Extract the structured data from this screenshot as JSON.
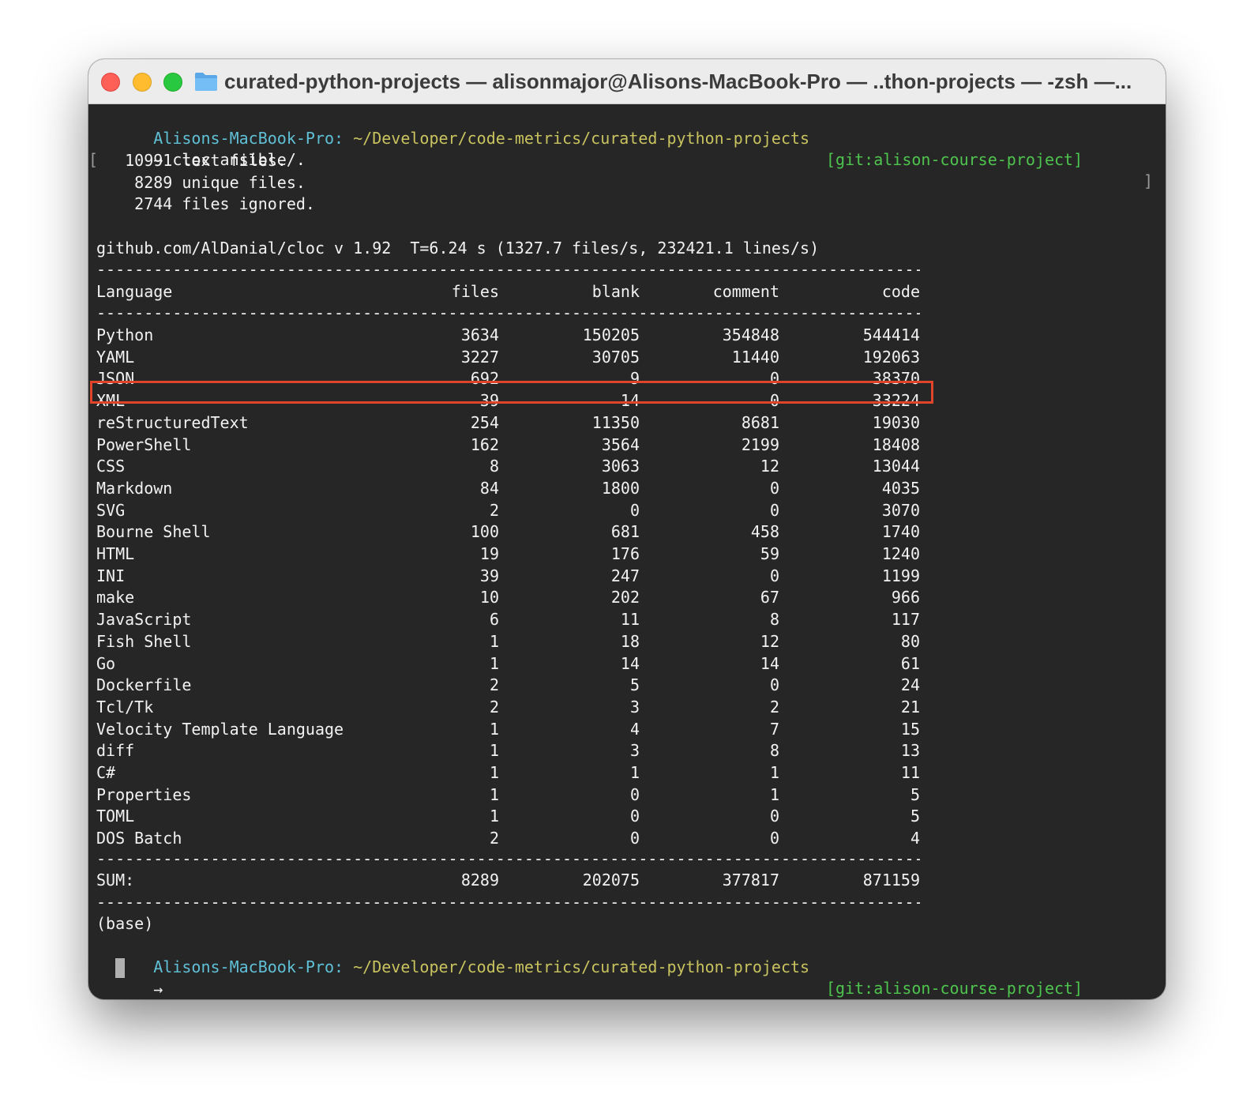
{
  "window": {
    "title": "curated-python-projects — alisonmajor@Alisons-MacBook-Pro — ..thon-projects — -zsh —..."
  },
  "prompt": {
    "host": "Alisons-MacBook-Pro:",
    "path": "~/Developer/code-metrics/curated-python-projects",
    "git": "[git:alison-course-project]",
    "arrow": "→"
  },
  "command": {
    "text": "cloc ansible/.",
    "left_bracket": "[",
    "right_bracket": "]"
  },
  "output": {
    "text_files": "   10991 text files.",
    "unique_files": "    8289 unique files.",
    "files_ignored": "    2744 files ignored.",
    "version_line": "github.com/AlDanial/cloc v 1.92  T=6.24 s (1327.7 files/s, 232421.1 lines/s)",
    "dashes": "---------------------------------------------------------------------------------------------------------------",
    "base": "(base)"
  },
  "table": {
    "headers": [
      "Language",
      "files",
      "blank",
      "comment",
      "code"
    ],
    "highlighted_row": "Python",
    "rows": [
      [
        "Python",
        "3634",
        "150205",
        "354848",
        "544414"
      ],
      [
        "YAML",
        "3227",
        "30705",
        "11440",
        "192063"
      ],
      [
        "JSON",
        "692",
        "9",
        "0",
        "38370"
      ],
      [
        "XML",
        "39",
        "14",
        "0",
        "33224"
      ],
      [
        "reStructuredText",
        "254",
        "11350",
        "8681",
        "19030"
      ],
      [
        "PowerShell",
        "162",
        "3564",
        "2199",
        "18408"
      ],
      [
        "CSS",
        "8",
        "3063",
        "12",
        "13044"
      ],
      [
        "Markdown",
        "84",
        "1800",
        "0",
        "4035"
      ],
      [
        "SVG",
        "2",
        "0",
        "0",
        "3070"
      ],
      [
        "Bourne Shell",
        "100",
        "681",
        "458",
        "1740"
      ],
      [
        "HTML",
        "19",
        "176",
        "59",
        "1240"
      ],
      [
        "INI",
        "39",
        "247",
        "0",
        "1199"
      ],
      [
        "make",
        "10",
        "202",
        "67",
        "966"
      ],
      [
        "JavaScript",
        "6",
        "11",
        "8",
        "117"
      ],
      [
        "Fish Shell",
        "1",
        "18",
        "12",
        "80"
      ],
      [
        "Go",
        "1",
        "14",
        "14",
        "61"
      ],
      [
        "Dockerfile",
        "2",
        "5",
        "0",
        "24"
      ],
      [
        "Tcl/Tk",
        "2",
        "3",
        "2",
        "21"
      ],
      [
        "Velocity Template Language",
        "1",
        "4",
        "7",
        "15"
      ],
      [
        "diff",
        "1",
        "3",
        "8",
        "13"
      ],
      [
        "C#",
        "1",
        "1",
        "1",
        "11"
      ],
      [
        "Properties",
        "1",
        "0",
        "1",
        "5"
      ],
      [
        "TOML",
        "1",
        "0",
        "0",
        "5"
      ],
      [
        "DOS Batch",
        "2",
        "0",
        "0",
        "4"
      ]
    ],
    "sum": [
      "SUM:",
      "8289",
      "202075",
      "377817",
      "871159"
    ]
  },
  "colors": {
    "terminal_bg": "#262626",
    "host": "#5fc0d6",
    "path": "#c9c35f",
    "git": "#4ec44e",
    "highlight_border": "#e0442a"
  },
  "icons": {
    "folder": "folder-icon",
    "close": "close-icon",
    "minimize": "minimize-icon",
    "zoom": "zoom-icon"
  }
}
